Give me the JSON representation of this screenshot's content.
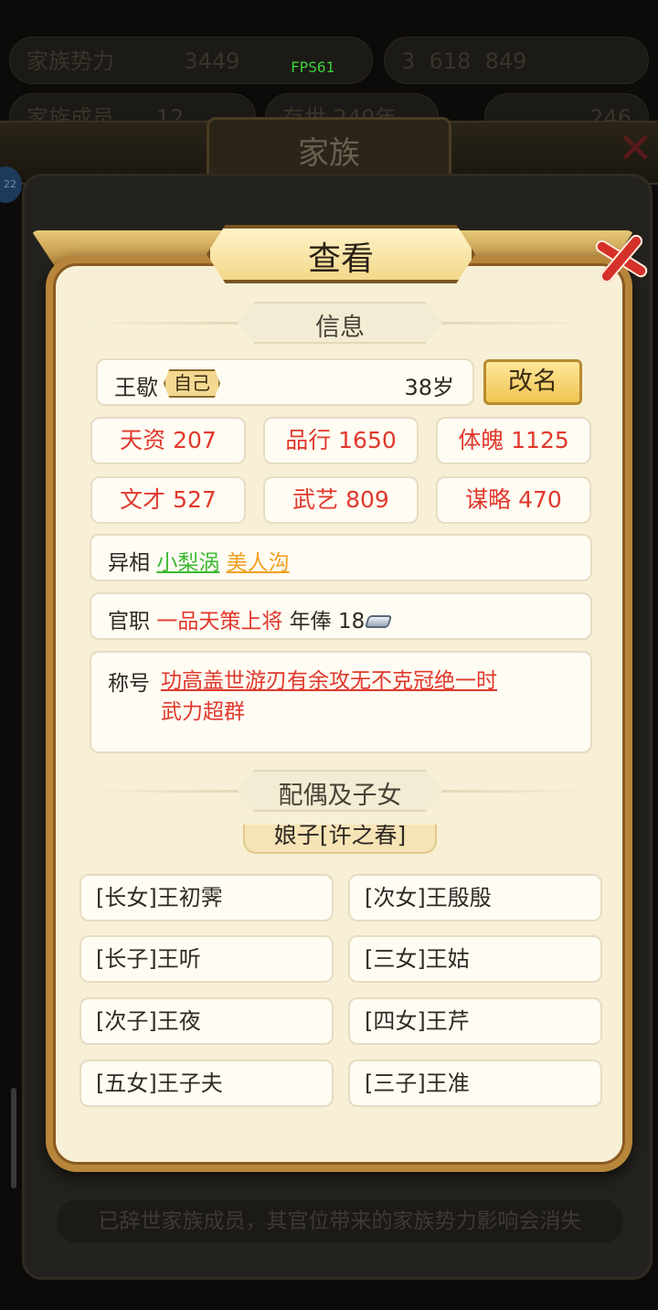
{
  "background": {
    "stats_row1": [
      "家族势力",
      "3449",
      "3",
      "618",
      "849"
    ],
    "stats_row2": [
      "家族成员",
      "12",
      "存世 240年",
      "246"
    ],
    "fps": "FPS61",
    "page_title": "家族",
    "avatar_badge": "22",
    "notice": "已辞世家族成员，其官位带来的家族势力影响会消失"
  },
  "dialog": {
    "title": "查看",
    "info_header": "信息",
    "name": "王歇",
    "self_badge": "自己",
    "age": "38岁",
    "rename_button": "改名",
    "attributes": [
      {
        "label": "天资 207"
      },
      {
        "label": "品行 1650"
      },
      {
        "label": "体魄 1125"
      },
      {
        "label": "文才 527"
      },
      {
        "label": "武艺 809"
      },
      {
        "label": "谋略 470"
      }
    ],
    "traits": {
      "label": "异相",
      "values": [
        "小梨涡",
        "美人沟"
      ]
    },
    "office": {
      "label": "官职",
      "rank": "一品天策上将",
      "salary_label": "年俸",
      "salary_value": "18"
    },
    "honor": {
      "label": "称号",
      "line1": "功高盖世游刃有余攻无不克冠绝一时",
      "line2": "武力超群"
    },
    "family_header": "配偶及子女",
    "spouse": "娘子[许之春]",
    "children": [
      "[长女]王初霁",
      "[次女]王殷殷",
      "[长子]王听",
      "[三女]王姑",
      "[次子]王夜",
      "[四女]王芹",
      "[五女]王子夫",
      "[三子]王准"
    ]
  },
  "colors": {
    "attribute_red": "#e0382c",
    "trait_green": "#3cb832",
    "trait_orange": "#f0a020",
    "panel_cream": "#f7f0d6",
    "frame_gold": "#b8863a"
  },
  "icons": [
    "silver-ingot-icon",
    "close-x-icon"
  ]
}
